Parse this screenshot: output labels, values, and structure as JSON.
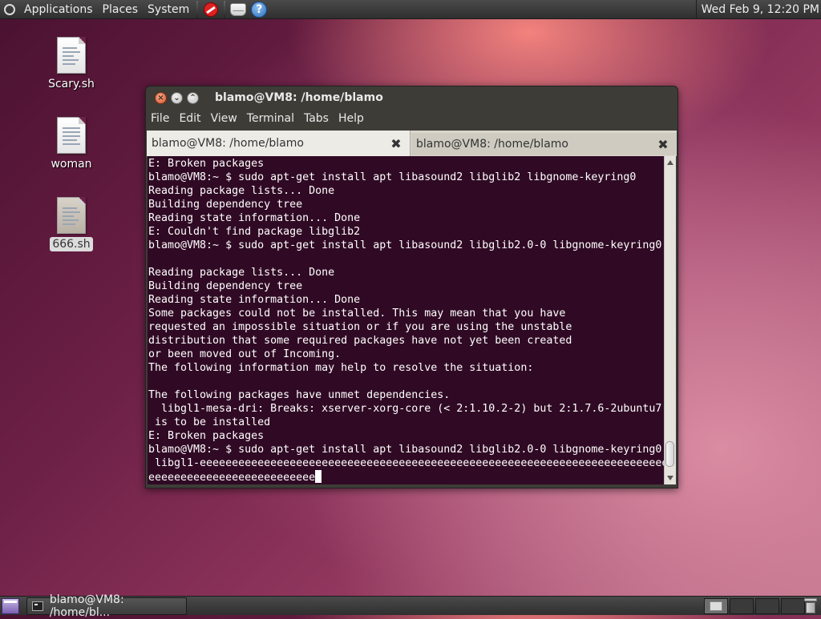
{
  "top_panel": {
    "menus": [
      "Applications",
      "Places",
      "System"
    ],
    "clock": "Wed Feb  9, 12:20 PM",
    "launchers": [
      "no-entry-icon",
      "mail-icon",
      "help-icon"
    ],
    "help_glyph": "?"
  },
  "desktop": {
    "icons": [
      {
        "label": "Scary.sh",
        "icon": "text-file-icon"
      },
      {
        "label": "woman",
        "icon": "text-file-icon"
      },
      {
        "label": "666.sh",
        "icon": "text-file-icon",
        "selected": true
      }
    ]
  },
  "window": {
    "title": "blamo@VM8: /home/blamo",
    "menu": [
      "File",
      "Edit",
      "View",
      "Terminal",
      "Tabs",
      "Help"
    ],
    "tabs": [
      {
        "label": "blamo@VM8: /home/blamo",
        "active": true
      },
      {
        "label": "blamo@VM8: /home/blamo",
        "active": false
      }
    ],
    "close_glyph": "✖",
    "terminal_lines": [
      "E: Broken packages",
      "blamo@VM8:~ $ sudo apt-get install apt libasound2 libglib2 libgnome-keyring0",
      "Reading package lists... Done",
      "Building dependency tree",
      "Reading state information... Done",
      "E: Couldn't find package libglib2",
      "blamo@VM8:~ $ sudo apt-get install apt libasound2 libglib2.0-0 libgnome-keyring0",
      "",
      "Reading package lists... Done",
      "Building dependency tree",
      "Reading state information... Done",
      "Some packages could not be installed. This may mean that you have",
      "requested an impossible situation or if you are using the unstable",
      "distribution that some required packages have not yet been created",
      "or been moved out of Incoming.",
      "The following information may help to resolve the situation:",
      "",
      "The following packages have unmet dependencies.",
      "  libgl1-mesa-dri: Breaks: xserver-xorg-core (< 2:1.10.2-2) but 2:1.7.6-2ubuntu7",
      " is to be installed",
      "E: Broken packages",
      "blamo@VM8:~ $ sudo apt-get install apt libasound2 libglib2.0-0 libgnome-keyring0",
      " libgl1-eeeeeeeeeeeeeeeeeeeeeeeeeeeeeeeeeeeeeeeeeeeeeeeeeeeeeeeeeeeeeeeeeeeeeeeee",
      "eeeeeeeeeeeeeeeeeeeeeeeeee"
    ]
  },
  "bottom_panel": {
    "task_label": "blamo@VM8: /home/bl...",
    "workspaces": 4,
    "active_workspace": 1
  },
  "colors": {
    "terminal_bg": "#300a24",
    "terminal_fg": "#ffffff",
    "panel_bg": "#3c3c3c"
  }
}
